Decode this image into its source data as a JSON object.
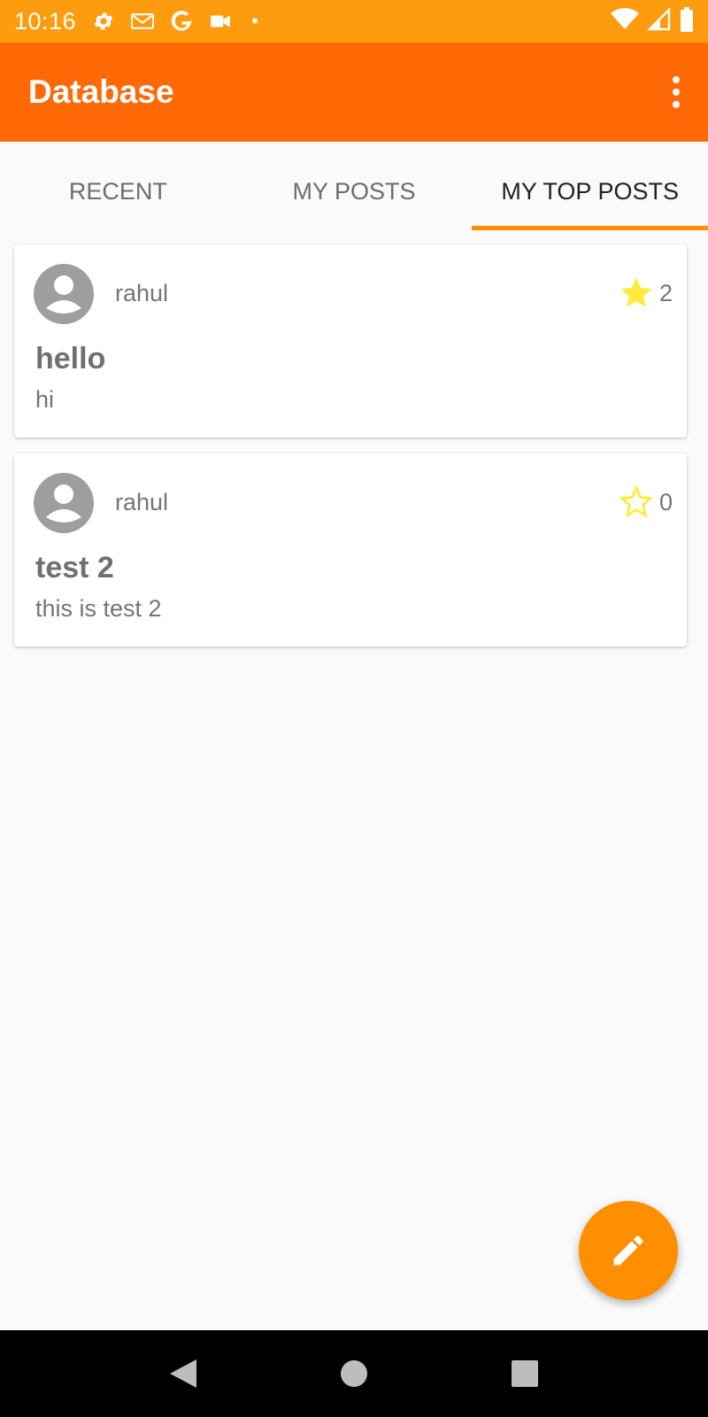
{
  "status_bar": {
    "time": "10:16",
    "left_icons": [
      "gear-icon",
      "gmail-icon",
      "google-icon",
      "video-icon",
      "dot-icon"
    ],
    "right_icons": [
      "wifi-icon",
      "signal-icon",
      "battery-icon"
    ]
  },
  "app_bar": {
    "title": "Database",
    "overflow_icon": "more-vert-icon"
  },
  "tabs": [
    {
      "label": "RECENT",
      "active": false
    },
    {
      "label": "MY POSTS",
      "active": false
    },
    {
      "label": "MY TOP POSTS",
      "active": true
    }
  ],
  "posts": [
    {
      "author": "rahul",
      "title": "hello",
      "body": "hi",
      "star_count": "2",
      "starred": true
    },
    {
      "author": "rahul",
      "title": "test 2",
      "body": "this is test 2",
      "star_count": "0",
      "starred": false
    }
  ],
  "fab": {
    "icon": "edit-pencil-icon"
  },
  "nav_bar": {
    "buttons": [
      "back-icon",
      "home-icon",
      "recents-icon"
    ]
  },
  "colors": {
    "status_bar": "#ff9b0f",
    "app_bar": "#ff6a07",
    "accent": "#ff8f00",
    "star": "#ffeb3b"
  }
}
